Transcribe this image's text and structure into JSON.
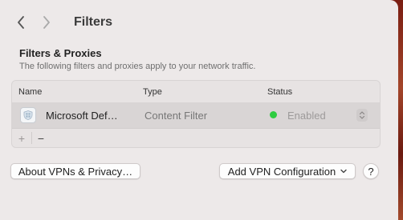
{
  "nav": {
    "title": "Filters"
  },
  "section": {
    "title": "Filters & Proxies",
    "description": "The following filters and proxies apply to your network traffic."
  },
  "table": {
    "columns": [
      "Name",
      "Type",
      "Status"
    ],
    "rows": [
      {
        "name": "Microsoft Def…",
        "type": "Content Filter",
        "status": "Enabled",
        "status_color": "#2ecc40",
        "icon": "microsoft-defender-icon"
      }
    ],
    "add_symbol": "+",
    "remove_symbol": "−"
  },
  "buttons": {
    "about": "About VPNs & Privacy…",
    "add_vpn": "Add VPN Configuration",
    "help": "?"
  },
  "colors": {
    "window_bg": "#ede9e9",
    "selected_row": "#d9d5d5"
  }
}
